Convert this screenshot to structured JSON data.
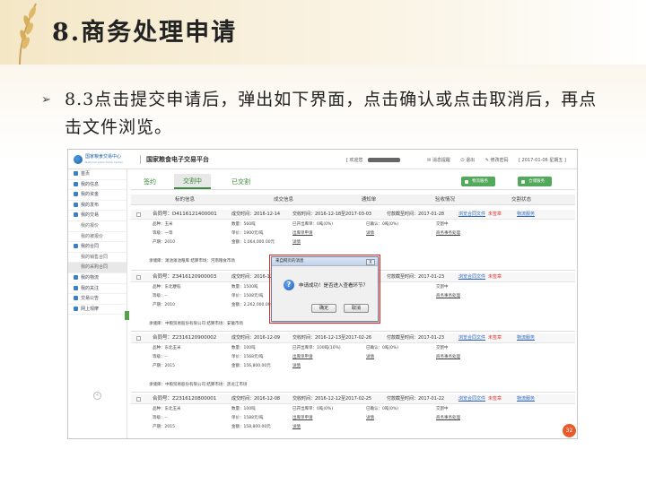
{
  "slide": {
    "title": "8.商务处理申请",
    "bullet_icon": "bullet-arrow-icon",
    "bullet_text": "8.3点击提交申请后，弹出如下界面，点击确认或点击取消后，再点击文件浏览。"
  },
  "app": {
    "logo_text": "国家粮食交易中心",
    "logo_sub": "National Grain Trade Center",
    "site_title": "国家粮食电子交易平台",
    "welcome": "[ 欢迎您",
    "msg": "消息提醒",
    "logout": "退出",
    "change_pwd": "修改密码",
    "date": "[ 2017-01-06 星期五 ]"
  },
  "sidebar": {
    "items": [
      {
        "label": "首页",
        "sub": false
      },
      {
        "label": "我的信息",
        "sub": false
      },
      {
        "label": "我的资金",
        "sub": false
      },
      {
        "label": "我的发布",
        "sub": false
      },
      {
        "label": "我的交易",
        "sub": false
      },
      {
        "label": "我的报价",
        "sub": true
      },
      {
        "label": "我的被报价",
        "sub": true
      },
      {
        "label": "我的合同",
        "sub": false
      },
      {
        "label": "我的销售合同",
        "sub": true
      },
      {
        "label": "我的采购合同",
        "sub": true
      },
      {
        "label": "我的物流",
        "sub": false
      },
      {
        "label": "我的关注",
        "sub": false
      },
      {
        "label": "交易公告",
        "sub": false
      },
      {
        "label": "网上观摩",
        "sub": false
      }
    ],
    "collapse_label": "«"
  },
  "tabs": [
    {
      "label": "签约"
    },
    {
      "label": "交割中"
    },
    {
      "label": "已交割"
    }
  ],
  "actions": {
    "logistics_service": "物流服务",
    "warehouse_service": "仓储服务"
  },
  "columns": [
    "标的信息",
    "成交信息",
    "通知单",
    "验收情况",
    "交割状态"
  ],
  "contracts": [
    {
      "no": "合同号：D4116121400001",
      "deal_time": "成交时间：2016-12-14",
      "notice_time": "交收时间：2016-12-18至2017-03-03",
      "pay_deadline": "付款截至时间：2017-01-28",
      "browse": "浏览合同文件",
      "status": "未签章",
      "logistics": "物流服务",
      "r1": [
        "品种：玉米",
        "数量：560吨",
        "已开出库单：0吨(0%)",
        "已确认：0吨(0%)",
        "交割中"
      ],
      "r2": [
        "等级：一等",
        "单价：1900元/吨",
        "出库单申请",
        "详情",
        "商务事务处理"
      ],
      "r3": [
        "产期：2010",
        "金额：1,064,000.00元",
        "详情"
      ],
      "store": "承储库：渑池渑池粮库    结算市场：河南粮食市场"
    },
    {
      "no": "合同号：Z3416120900003",
      "deal_time": "成交时间：2016-12-09",
      "notice_time": "",
      "pay_deadline": "付款截至时间：2017-01-23",
      "browse": "浏览合同文件",
      "status": "未签章",
      "logistics": "",
      "r1": [
        "品种：东北粳稻",
        "数量：1500吨",
        "",
        "",
        "交割中"
      ],
      "r2": [
        "等级：--",
        "单价：1508元/吨",
        "",
        "",
        "商务事务处理"
      ],
      "r3": [
        "产期：2010",
        "金额：2,262,000.00元",
        "详情"
      ],
      "store": "承储库：中粮贸易股份有限公司    结算市场：安徽市场"
    },
    {
      "no": "合同号：Z2316120900002",
      "deal_time": "成交时间：2016-12-09",
      "notice_time": "交收时间：2016-12-13至2017-02-26",
      "pay_deadline": "付款截至时间：2017-01-23",
      "browse": "浏览合同文件",
      "status": "未签章",
      "logistics": "物流服务",
      "r1": [
        "品种：东北玉米",
        "数量：100吨",
        "已开出库单：100吨(10%)",
        "已确认：0吨(0%)",
        "交割中"
      ],
      "r2": [
        "等级：--",
        "单价：1568元/吨",
        "出库单申请",
        "详情",
        "商务事务处理"
      ],
      "r3": [
        "产期：2015",
        "金额：156,800.00元",
        "详情"
      ],
      "store": "承储库：中粮贸易股份有限公司    结算市场：黑龙江市场"
    },
    {
      "no": "合同号：Z2316120800001",
      "deal_time": "成交时间：2016-12-08",
      "notice_time": "交收时间：2016-12-12至2017-02-25",
      "pay_deadline": "付款截至时间：2017-01-22",
      "browse": "浏览合同文件",
      "status": "未签章",
      "logistics": "物流服务",
      "r1": [
        "品种：东北玉米",
        "数量：100吨",
        "已开出库单：0吨(0%)",
        "已确认：0吨(0%)",
        "交割中"
      ],
      "r2": [
        "等级：--",
        "单价：1588元/吨",
        "出库单申请",
        "详情",
        "商务事务处理"
      ],
      "r3": [
        "产期：2015",
        "金额：158,800.00元",
        "详情"
      ],
      "store": ""
    }
  ],
  "dialog": {
    "title": "来自网页的消息",
    "close_label": "X",
    "icon": "question-icon",
    "icon_glyph": "?",
    "message": "申请成功！是否进入查看环节？",
    "ok": "确定",
    "cancel": "取消"
  },
  "chat_badge": "32"
}
